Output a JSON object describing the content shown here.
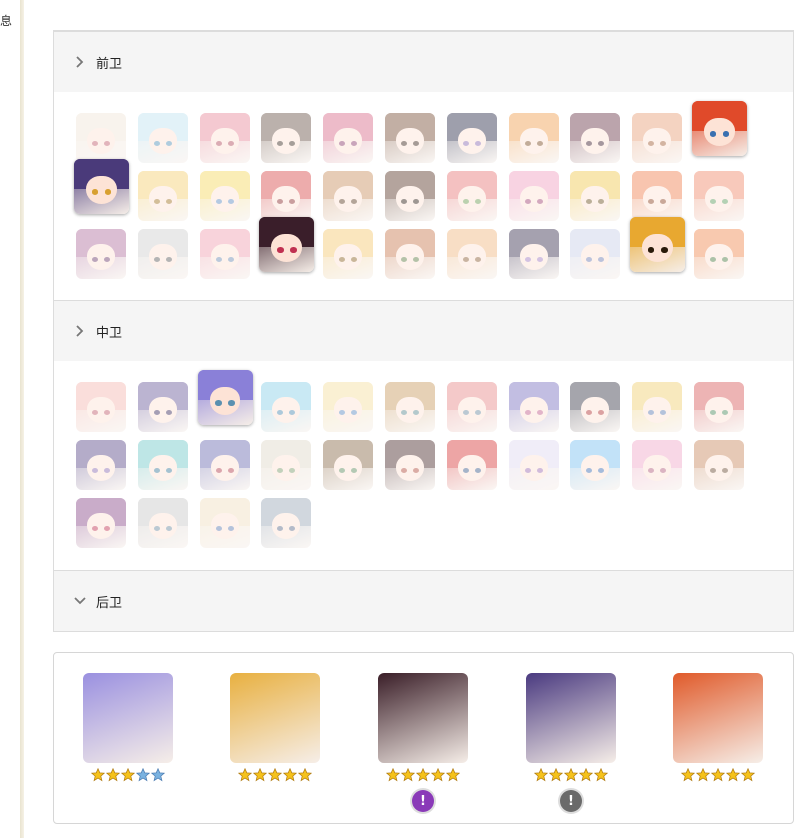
{
  "side_text": "息",
  "sections": [
    {
      "id": "front",
      "title": "前卫",
      "chevron": "chevron-right-icon"
    },
    {
      "id": "middle",
      "title": "中卫",
      "chevron": "chevron-right-icon"
    },
    {
      "id": "back",
      "title": "后卫",
      "chevron": "chevron-down-icon"
    }
  ],
  "front_characters": [
    {
      "hair": "#f0e6d8",
      "eye": "#c05a6a",
      "selected": false
    },
    {
      "hair": "#bfe3f0",
      "eye": "#4f8fb8",
      "selected": false
    },
    {
      "hair": "#e88a9a",
      "eye": "#b04a5a",
      "selected": false
    },
    {
      "hair": "#6a5448",
      "eye": "#3a2a20",
      "selected": false
    },
    {
      "hair": "#d86a8a",
      "eye": "#8a3a6a",
      "selected": false
    },
    {
      "hair": "#7a5038",
      "eye": "#3a2418",
      "selected": false
    },
    {
      "hair": "#2a2c4a",
      "eye": "#8a6ab0",
      "selected": false
    },
    {
      "hair": "#f0a050",
      "eye": "#7a4a20",
      "selected": false
    },
    {
      "hair": "#6a3848",
      "eye": "#3a1a2a",
      "selected": false
    },
    {
      "hair": "#e8a078",
      "eye": "#a05a30",
      "selected": false
    },
    {
      "hair": "#e04a2a",
      "eye": "#3a70b0",
      "selected": true
    },
    {
      "hair": "#4a3a7a",
      "eye": "#d8a030",
      "selected": true
    },
    {
      "hair": "#f4d070",
      "eye": "#a07020",
      "selected": false
    },
    {
      "hair": "#f6d860",
      "eye": "#5a8ac0",
      "selected": false
    },
    {
      "hair": "#d84a4a",
      "eye": "#8a2a2a",
      "selected": false
    },
    {
      "hair": "#c89060",
      "eye": "#5a3a20",
      "selected": false
    },
    {
      "hair": "#5a3828",
      "eye": "#2a1a10",
      "selected": false
    },
    {
      "hair": "#e87878",
      "eye": "#6a9a50",
      "selected": false
    },
    {
      "hair": "#f0a0c0",
      "eye": "#a04070",
      "selected": false
    },
    {
      "hair": "#f0c850",
      "eye": "#6a5020",
      "selected": false
    },
    {
      "hair": "#f08050",
      "eye": "#8a4020",
      "selected": false
    },
    {
      "hair": "#f08a6a",
      "eye": "#5a9a5a",
      "selected": false
    },
    {
      "hair": "#b070a0",
      "eye": "#6a3a6a",
      "selected": false
    },
    {
      "hair": "#d0d0d0",
      "eye": "#5a5a5a",
      "selected": false
    },
    {
      "hair": "#f0a0b0",
      "eye": "#6a8ab0",
      "selected": false
    },
    {
      "hair": "#3a1e2a",
      "eye": "#c03050",
      "selected": true
    },
    {
      "hair": "#f4c870",
      "eye": "#8a6020",
      "selected": false
    },
    {
      "hair": "#c87a50",
      "eye": "#5a7a40",
      "selected": false
    },
    {
      "hair": "#f0b880",
      "eye": "#8a5a30",
      "selected": false
    },
    {
      "hair": "#3a3050",
      "eye": "#a07ac0",
      "selected": false
    },
    {
      "hair": "#c8d0e8",
      "eye": "#6a7ab0",
      "selected": false
    },
    {
      "hair": "#e8a830",
      "eye": "#2a1a0a",
      "selected": true
    },
    {
      "hair": "#f08a50",
      "eye": "#4a7a40",
      "selected": false
    }
  ],
  "middle_characters": [
    {
      "hair": "#f4b8b0",
      "eye": "#c05a6a"
    },
    {
      "hair": "#6a5a9a",
      "eye": "#3a2a5a"
    },
    {
      "hair": "#8a80d8",
      "eye": "#5a90b0",
      "selected": true
    },
    {
      "hair": "#8ad0e8",
      "eye": "#4a8ab0"
    },
    {
      "hair": "#f4e0a0",
      "eye": "#5a8ac0"
    },
    {
      "hair": "#c89a60",
      "eye": "#5a8a90"
    },
    {
      "hair": "#e88a8a",
      "eye": "#6a8aa0"
    },
    {
      "hair": "#7a70c0",
      "eye": "#c05a8a"
    },
    {
      "hair": "#3a3a48",
      "eye": "#b03030"
    },
    {
      "hair": "#f0d070",
      "eye": "#5a7ab0"
    },
    {
      "hair": "#d85a5a",
      "eye": "#4a8a5a"
    },
    {
      "hair": "#5a4a8a",
      "eye": "#8a6ab0"
    },
    {
      "hair": "#70c8c8",
      "eye": "#3a7a9a"
    },
    {
      "hair": "#6a6ab0",
      "eye": "#b03a4a"
    },
    {
      "hair": "#e0d8c8",
      "eye": "#7a9a6a"
    },
    {
      "hair": "#8a6a48",
      "eye": "#5a8a5a"
    },
    {
      "hair": "#4a2a2a",
      "eye": "#b04a3a"
    },
    {
      "hair": "#d83a3a",
      "eye": "#3a5a8a"
    },
    {
      "hair": "#e0d8f0",
      "eye": "#9a6ab0"
    },
    {
      "hair": "#7ac0f0",
      "eye": "#3a6ab0"
    },
    {
      "hair": "#f0a8c8",
      "eye": "#b05a7a"
    },
    {
      "hair": "#c88a60",
      "eye": "#6a4a30"
    },
    {
      "hair": "#8a4a8a",
      "eye": "#c03050"
    },
    {
      "hair": "#c8c8c8",
      "eye": "#6a8aa0"
    },
    {
      "hair": "#f0e0c0",
      "eye": "#5a7ab0"
    },
    {
      "hair": "#9aa8b8",
      "eye": "#5a6a8a"
    }
  ],
  "team": [
    {
      "hair": "#9a90e0",
      "eye": "#3a80b0",
      "stars": [
        1,
        1,
        1,
        0,
        0
      ],
      "badge": null
    },
    {
      "hair": "#e8b040",
      "eye": "#b05a20",
      "stars": [
        1,
        1,
        1,
        1,
        1
      ],
      "badge": null
    },
    {
      "hair": "#3a1e28",
      "eye": "#d03a6a",
      "stars": [
        1,
        1,
        1,
        1,
        1
      ],
      "badge": {
        "color": "#8a3ab8",
        "glyph": "!"
      }
    },
    {
      "hair": "#4a3a80",
      "eye": "#d8a030",
      "stars": [
        1,
        1,
        1,
        1,
        1
      ],
      "badge": {
        "color": "#6a6a6a",
        "glyph": "!"
      }
    },
    {
      "hair": "#e05a2a",
      "eye": "#3a70b0",
      "stars": [
        1,
        1,
        1,
        1,
        1
      ],
      "badge": null
    }
  ],
  "colors": {
    "star_gold": "#f5c21b",
    "star_blue": "#7ab2e0"
  }
}
